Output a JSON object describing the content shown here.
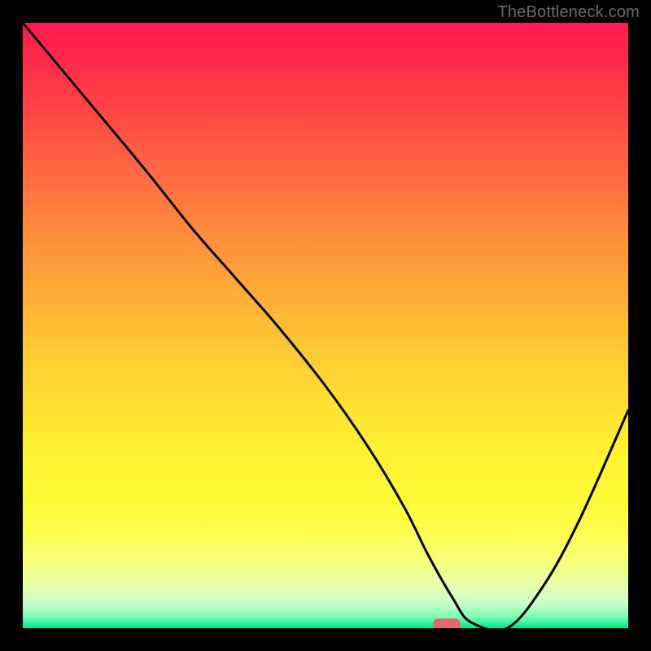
{
  "watermark": "TheBottleneck.com",
  "chart_data": {
    "type": "line",
    "title": "",
    "xlabel": "",
    "ylabel": "",
    "xlim": [
      0,
      100
    ],
    "ylim": [
      0,
      100
    ],
    "background_gradient": {
      "top": "#ff1a4f",
      "bottom": "#00e58f",
      "stops": [
        {
          "pos": 0,
          "color": "#ff1a4f"
        },
        {
          "pos": 50,
          "color": "#ffc933"
        },
        {
          "pos": 85,
          "color": "#feff4d"
        },
        {
          "pos": 100,
          "color": "#00e58f"
        }
      ]
    },
    "series": [
      {
        "name": "bottleneck-curve",
        "x": [
          0,
          10,
          20,
          28,
          35,
          42,
          50,
          57,
          63,
          67,
          71,
          74,
          80,
          86,
          92,
          100
        ],
        "y": [
          100,
          88,
          76,
          66,
          58,
          50,
          40,
          30,
          20,
          12,
          5,
          1,
          0,
          7,
          18,
          36
        ]
      }
    ],
    "marker": {
      "name": "optimal-point",
      "x": 70,
      "y": 0.7,
      "color": "#e26a6a",
      "shape": "pill"
    }
  }
}
